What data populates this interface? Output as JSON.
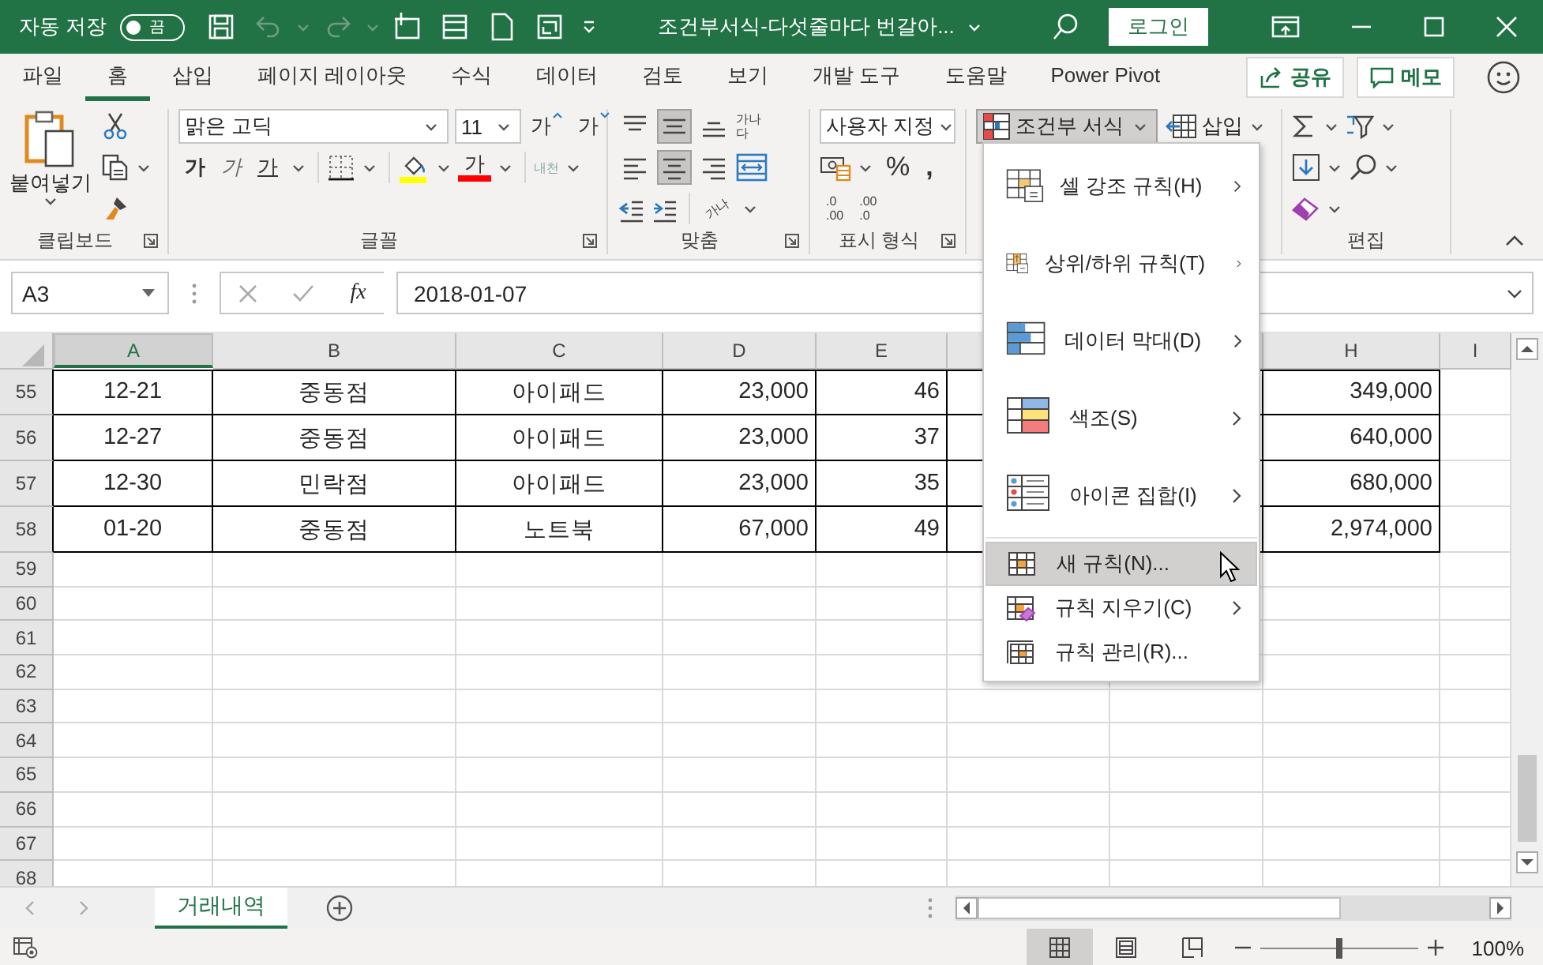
{
  "title_bar": {
    "autosave_label": "자동 저장",
    "autosave": {
      "on": false,
      "label": "끔"
    },
    "quick_access": [
      {
        "kind": "save",
        "disabled": false
      },
      {
        "kind": "undo",
        "disabled": true
      },
      {
        "kind": "redo",
        "disabled": true
      },
      {
        "kind": "frame",
        "disabled": false
      },
      {
        "kind": "form",
        "disabled": false
      },
      {
        "kind": "page",
        "disabled": false
      },
      {
        "kind": "preview",
        "disabled": false
      }
    ],
    "document_title": "조건부서식-다섯줄마다 번갈아...",
    "login_button": "로그인"
  },
  "ribbon_tabs": [
    {
      "label": "파일",
      "selected": false
    },
    {
      "label": "홈",
      "selected": true
    },
    {
      "label": "삽입",
      "selected": false
    },
    {
      "label": "페이지 레이아웃",
      "selected": false
    },
    {
      "label": "수식",
      "selected": false
    },
    {
      "label": "데이터",
      "selected": false
    },
    {
      "label": "검토",
      "selected": false
    },
    {
      "label": "보기",
      "selected": false
    },
    {
      "label": "개발 도구",
      "selected": false
    },
    {
      "label": "도움말",
      "selected": false
    },
    {
      "label": "Power Pivot",
      "selected": false
    }
  ],
  "share_button": "공유",
  "comments_button": "메모",
  "clipboard": {
    "paste": "붙여넣기",
    "label": "클립보드"
  },
  "font": {
    "name": "맑은 고딕",
    "size": "11",
    "grow": "가",
    "shrink": "가",
    "bold": "가",
    "italic": "가",
    "underline": "가",
    "font_color": "가",
    "phonetic": "내천",
    "label": "글꼴"
  },
  "alignment": {
    "wrap_glyph": "가나다",
    "orientation_glyph": "가나",
    "label": "맞춤",
    "buttons": [
      {
        "kind": "top",
        "pressed": false
      },
      {
        "kind": "middle",
        "pressed": true
      },
      {
        "kind": "bottom",
        "pressed": false
      },
      {
        "kind": "left",
        "pressed": false
      },
      {
        "kind": "center",
        "pressed": true
      },
      {
        "kind": "right",
        "pressed": false
      }
    ]
  },
  "number": {
    "format": "사용자 지정",
    "percent": "%",
    "comma": ",",
    "increase_decimal": [
      ".0",
      ".00"
    ],
    "decrease_decimal": [
      ".00",
      ".0"
    ],
    "label": "표시 형식"
  },
  "styles": {
    "conditional_formatting": "조건부 서식",
    "open": true
  },
  "cells": {
    "insert": "삽입"
  },
  "editing": {
    "label": "편집"
  },
  "formula_bar": {
    "name_box": "A3",
    "function_label": "fx",
    "value": "2018-01-07"
  },
  "sheet": {
    "columns": [
      {
        "label": "A",
        "selected": true
      },
      {
        "label": "B",
        "selected": false
      },
      {
        "label": "C",
        "selected": false
      },
      {
        "label": "D",
        "selected": false
      },
      {
        "label": "E",
        "selected": false
      },
      {
        "selected": false
      },
      {
        "selected": false
      },
      {
        "label": "H",
        "selected": false
      },
      {
        "label": "I",
        "selected": false
      }
    ],
    "rows": [
      {
        "number": "55",
        "bordered": true,
        "cells": [
          "12-21",
          "중동점",
          "아이패드",
          "23,000",
          "46",
          null,
          null,
          "349,000"
        ]
      },
      {
        "number": "56",
        "bordered": true,
        "cells": [
          "12-27",
          "중동점",
          "아이패드",
          "23,000",
          "37",
          null,
          null,
          "640,000"
        ]
      },
      {
        "number": "57",
        "bordered": true,
        "cells": [
          "12-30",
          "민락점",
          "아이패드",
          "23,000",
          "35",
          null,
          null,
          "680,000"
        ]
      },
      {
        "number": "58",
        "bordered": true,
        "cells": [
          "01-20",
          "중동점",
          "노트북",
          "67,000",
          "49",
          null,
          null,
          "2,974,000"
        ]
      },
      {
        "number": "59",
        "bordered": false
      },
      {
        "number": "60",
        "bordered": false
      },
      {
        "number": "61",
        "bordered": false
      },
      {
        "number": "62",
        "bordered": false
      },
      {
        "number": "63",
        "bordered": false
      },
      {
        "number": "64",
        "bordered": false
      },
      {
        "number": "65",
        "bordered": false
      },
      {
        "number": "66",
        "bordered": false
      },
      {
        "number": "67",
        "bordered": false
      },
      {
        "number": "68",
        "bordered": false
      }
    ]
  },
  "conditional_menu": {
    "items": [
      {
        "kind": "large",
        "label": "셀 강조 규칙(H)",
        "submenu": true,
        "selected": false
      },
      {
        "kind": "large",
        "label": "상위/하위 규칙(T)",
        "submenu": true,
        "selected": false
      },
      {
        "kind": "large",
        "label": "데이터 막대(D)",
        "submenu": true,
        "selected": false
      },
      {
        "kind": "large",
        "label": "색조(S)",
        "submenu": true,
        "selected": false
      },
      {
        "kind": "large",
        "label": "아이콘 집합(I)",
        "submenu": true,
        "selected": false
      },
      {
        "kind": "small",
        "label": "새 규칙(N)...",
        "submenu": false,
        "selected": true
      },
      {
        "kind": "small",
        "label": "규칙 지우기(C)",
        "submenu": true,
        "selected": false
      },
      {
        "kind": "small",
        "label": "규칙 관리(R)...",
        "submenu": false,
        "selected": false
      }
    ]
  },
  "sheet_tabs": [
    {
      "label": "거래내역",
      "selected": true
    }
  ],
  "status_bar": {
    "views": [
      {
        "kind": "normal",
        "selected": true
      },
      {
        "kind": "page_layout",
        "selected": false
      },
      {
        "kind": "page_break",
        "selected": false
      }
    ],
    "zoom": {
      "level": 0.5,
      "label": "100%"
    }
  }
}
